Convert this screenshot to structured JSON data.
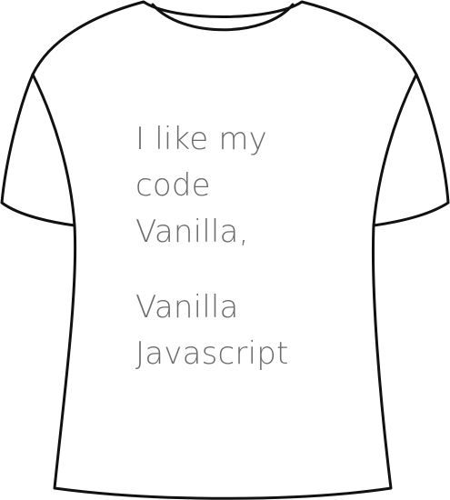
{
  "shirt": {
    "outline_color": "#111111",
    "fill_color": "#ffffff",
    "print": {
      "text_color": "#6b6b6b",
      "verse_one": [
        "I like my",
        "code",
        "Vanilla,"
      ],
      "verse_two": [
        "Vanilla",
        "Javascript"
      ]
    }
  }
}
